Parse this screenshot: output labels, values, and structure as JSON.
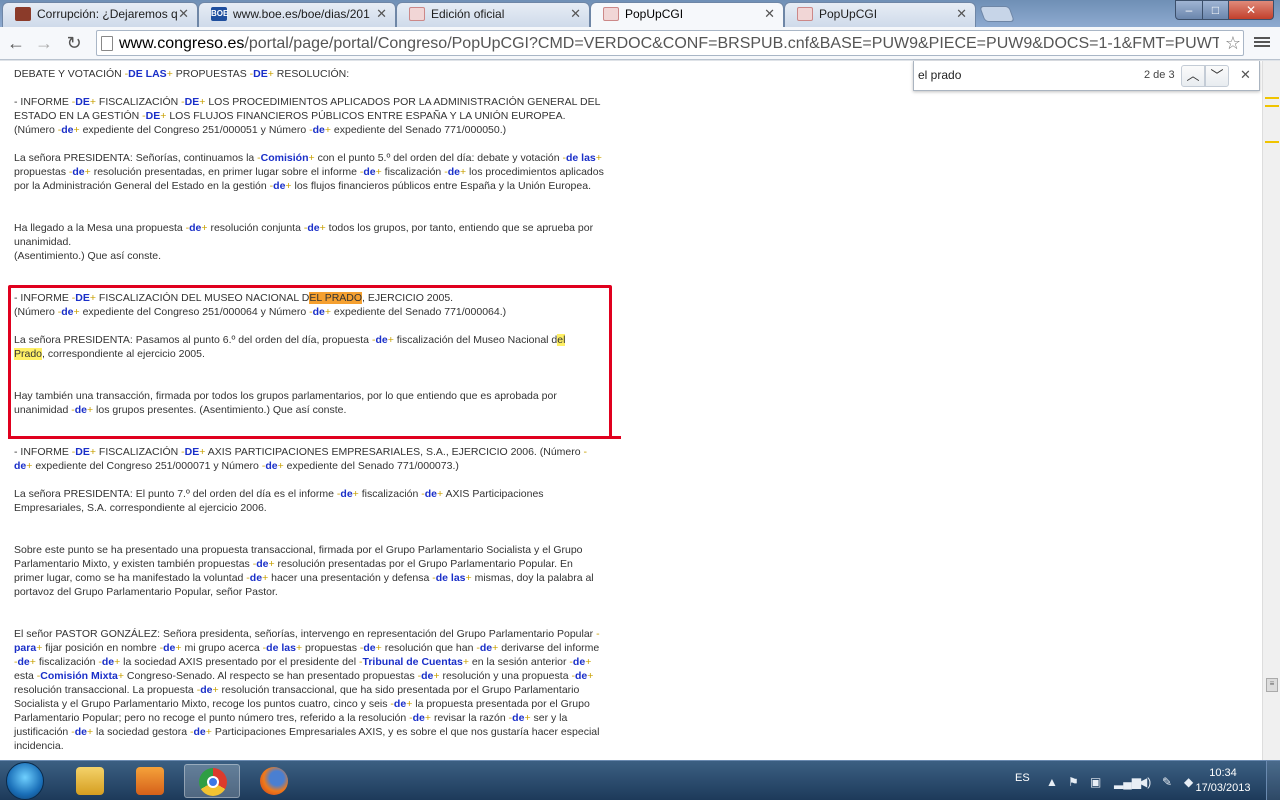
{
  "tabs": [
    {
      "title": "Corrupción: ¿Dejaremos q",
      "favicon": "book-favicon-icon"
    },
    {
      "title": "www.boe.es/boe/dias/201",
      "favicon": "boe-favicon-icon",
      "favicon_text": "BOE"
    },
    {
      "title": "Edición oficial",
      "favicon": "congreso-favicon-icon"
    },
    {
      "title": "PopUpCGI",
      "favicon": "congreso-favicon-icon",
      "active": true
    },
    {
      "title": "PopUpCGI",
      "favicon": "congreso-favicon-icon"
    }
  ],
  "window_controls": {
    "minimize": "–",
    "maximize": "□",
    "close": "✕"
  },
  "toolbar": {
    "back": "←",
    "forward": "→",
    "reload": "↻",
    "url_host": "www.congreso.es",
    "url_rest": "/portal/page/portal/Congreso/PopUpCGI?CMD=VERDOC&CONF=BRSPUB.cnf&BASE=PUW9&PIECE=PUW9&DOCS=1-1&FMT=PUWTXDTS.fmt&OPD",
    "star": "☆"
  },
  "find_bar": {
    "query": "el prado",
    "count": "2 de 3",
    "prev": "︿",
    "next": "﹀",
    "close": "✕"
  },
  "document": {
    "p1": [
      "DEBATE Y VOTACIÓN ",
      "-",
      "DE LAS",
      "+",
      " PROPUESTAS ",
      "-",
      "DE",
      "+",
      " RESOLUCIÓN:"
    ],
    "p2": [
      "- INFORME ",
      "-",
      "DE",
      "+",
      " FISCALIZACIÓN ",
      "-",
      "DE",
      "+",
      " LOS PROCEDIMIENTOS APLICADOS POR LA ADMINISTRACIÓN GENERAL DEL ESTADO EN LA GESTIÓN ",
      "-",
      "DE",
      "+",
      " LOS FLUJOS FINANCIEROS PÚBLICOS ENTRE ESPAÑA Y LA UNIÓN EUROPEA. (Número ",
      "-",
      "de",
      "+",
      " expediente del Congreso 251/000051 y Número ",
      "-",
      "de",
      "+",
      " expediente del Senado 771/000050.)"
    ],
    "p3": [
      "La señora PRESIDENTA: Señorías, continuamos la ",
      "-",
      "Comisión",
      "+",
      " con el punto 5.º del orden del día: debate y votación ",
      "-",
      "de las",
      "+",
      " propuestas ",
      "-",
      "de",
      "+",
      " resolución presentadas, en primer lugar sobre el informe ",
      "-",
      "de",
      "+",
      " fiscalización ",
      "-",
      "de",
      "+",
      " los procedimientos aplicados por la Administración General del Estado en la gestión ",
      "-",
      "de",
      "+",
      " los flujos financieros públicos entre España y la Unión Europea."
    ],
    "p4a": [
      "Ha llegado a la Mesa una propuesta ",
      "-",
      "de",
      "+",
      " resolución conjunta ",
      "-",
      "de",
      "+",
      " todos los grupos, por tanto, entiendo que se aprueba por unanimidad."
    ],
    "p4b": "(Asentimiento.) Que así conste.",
    "p5a": [
      "- INFORME ",
      "-",
      "DE",
      "+",
      " FISCALIZACIÓN DEL MUSEO NACIONAL D"
    ],
    "p5_hl": "EL PRADO",
    "p5b": ", EJERCICIO 2005.",
    "p5c": [
      "(Número ",
      "-",
      "de",
      "+",
      " expediente del Congreso 251/000064 y Número ",
      "-",
      "de",
      "+",
      " expediente del Senado 771/000064.)"
    ],
    "p6a": [
      "La señora PRESIDENTA: Pasamos al punto 6.º del orden del día, propuesta ",
      "-",
      "de",
      "+",
      " fiscalización del Museo Nacional d"
    ],
    "p6_hl1": "el",
    "p6_hl2": "Prado",
    "p6b": ", correspondiente al ejercicio 2005.",
    "p7": [
      "Hay también una transacción, firmada por todos los grupos parlamentarios, por lo que entiendo que es aprobada por unanimidad ",
      "-",
      "de",
      "+",
      " los grupos presentes. (Asentimiento.) Que así conste."
    ],
    "p8": [
      "- INFORME ",
      "-",
      "DE",
      "+",
      " FISCALIZACIÓN ",
      "-",
      "DE",
      "+",
      " AXIS PARTICIPACIONES EMPRESARIALES, S.A., EJERCICIO 2006. (Número ",
      "-",
      "de",
      "+",
      " expediente del Congreso 251/000071 y Número ",
      "-",
      "de",
      "+",
      " expediente del Senado 771/000073.)"
    ],
    "p9": [
      "La señora PRESIDENTA: El punto 7.º del orden del día es el informe ",
      "-",
      "de",
      "+",
      " fiscalización ",
      "-",
      "de",
      "+",
      " AXIS Participaciones Empresariales, S.A. correspondiente al ejercicio 2006."
    ],
    "p10": [
      "Sobre este punto se ha presentado una propuesta transaccional, firmada por el Grupo Parlamentario Socialista y el Grupo Parlamentario Mixto, y existen también propuestas ",
      "-",
      "de",
      "+",
      " resolución presentadas por el Grupo Parlamentario Popular. En primer lugar, como se ha manifestado la voluntad ",
      "-",
      "de",
      "+",
      " hacer una presentación y defensa ",
      "-",
      "de las",
      "+",
      " mismas, doy la palabra al portavoz del Grupo Parlamentario Popular, señor Pastor."
    ],
    "p11": [
      "El señor PASTOR GONZÁLEZ: Señora presidenta, señorías, intervengo en representación del Grupo Parlamentario Popular ",
      "-",
      "para",
      "+",
      " fijar posición en nombre ",
      "-",
      "de",
      "+",
      " mi grupo acerca ",
      "-",
      "de las",
      "+",
      " propuestas ",
      "-",
      "de",
      "+",
      " resolución que han ",
      "-",
      "de",
      "+",
      " derivarse del informe ",
      "-",
      "de",
      "+",
      " fiscalización ",
      "-",
      "de",
      "+",
      " la sociedad AXIS presentado por el presidente del ",
      "-",
      "Tribunal de Cuentas",
      "+",
      " en la sesión anterior ",
      "-",
      "de",
      "+",
      " esta ",
      "-",
      "Comisión Mixta",
      "+",
      " Congreso-Senado. Al respecto se han presentado propuestas ",
      "-",
      "de",
      "+",
      " resolución y una propuesta ",
      "-",
      "de",
      "+",
      " resolución transaccional. La propuesta ",
      "-",
      "de",
      "+",
      " resolución transaccional, que ha sido presentada por el Grupo Parlamentario Socialista y el Grupo Parlamentario Mixto, recoge los puntos cuatro, cinco y seis ",
      "-",
      "de",
      "+",
      " la propuesta presentada por el Grupo Parlamentario Popular; pero no recoge el punto número tres, referido a la resolución ",
      "-",
      "de",
      "+",
      " revisar la razón ",
      "-",
      "de",
      "+",
      " ser y la justificación ",
      "-",
      "de",
      "+",
      " la sociedad gestora ",
      "-",
      "de",
      "+",
      " Participaciones Empresariales AXIS, y es sobre el que nos gustaría hacer especial incidencia."
    ]
  },
  "taskbar": {
    "apps": [
      "windows-explorer-icon",
      "media-center-icon",
      "chrome-icon",
      "firefox-icon"
    ],
    "lang": "ES",
    "time": "10:34",
    "date": "17/03/2013"
  },
  "colors": {
    "highlight_current": "#f5a030",
    "highlight": "#fff066",
    "keyword": "#1a2fc8",
    "marker": "#c8a000",
    "annotation_box": "#e0001e"
  }
}
